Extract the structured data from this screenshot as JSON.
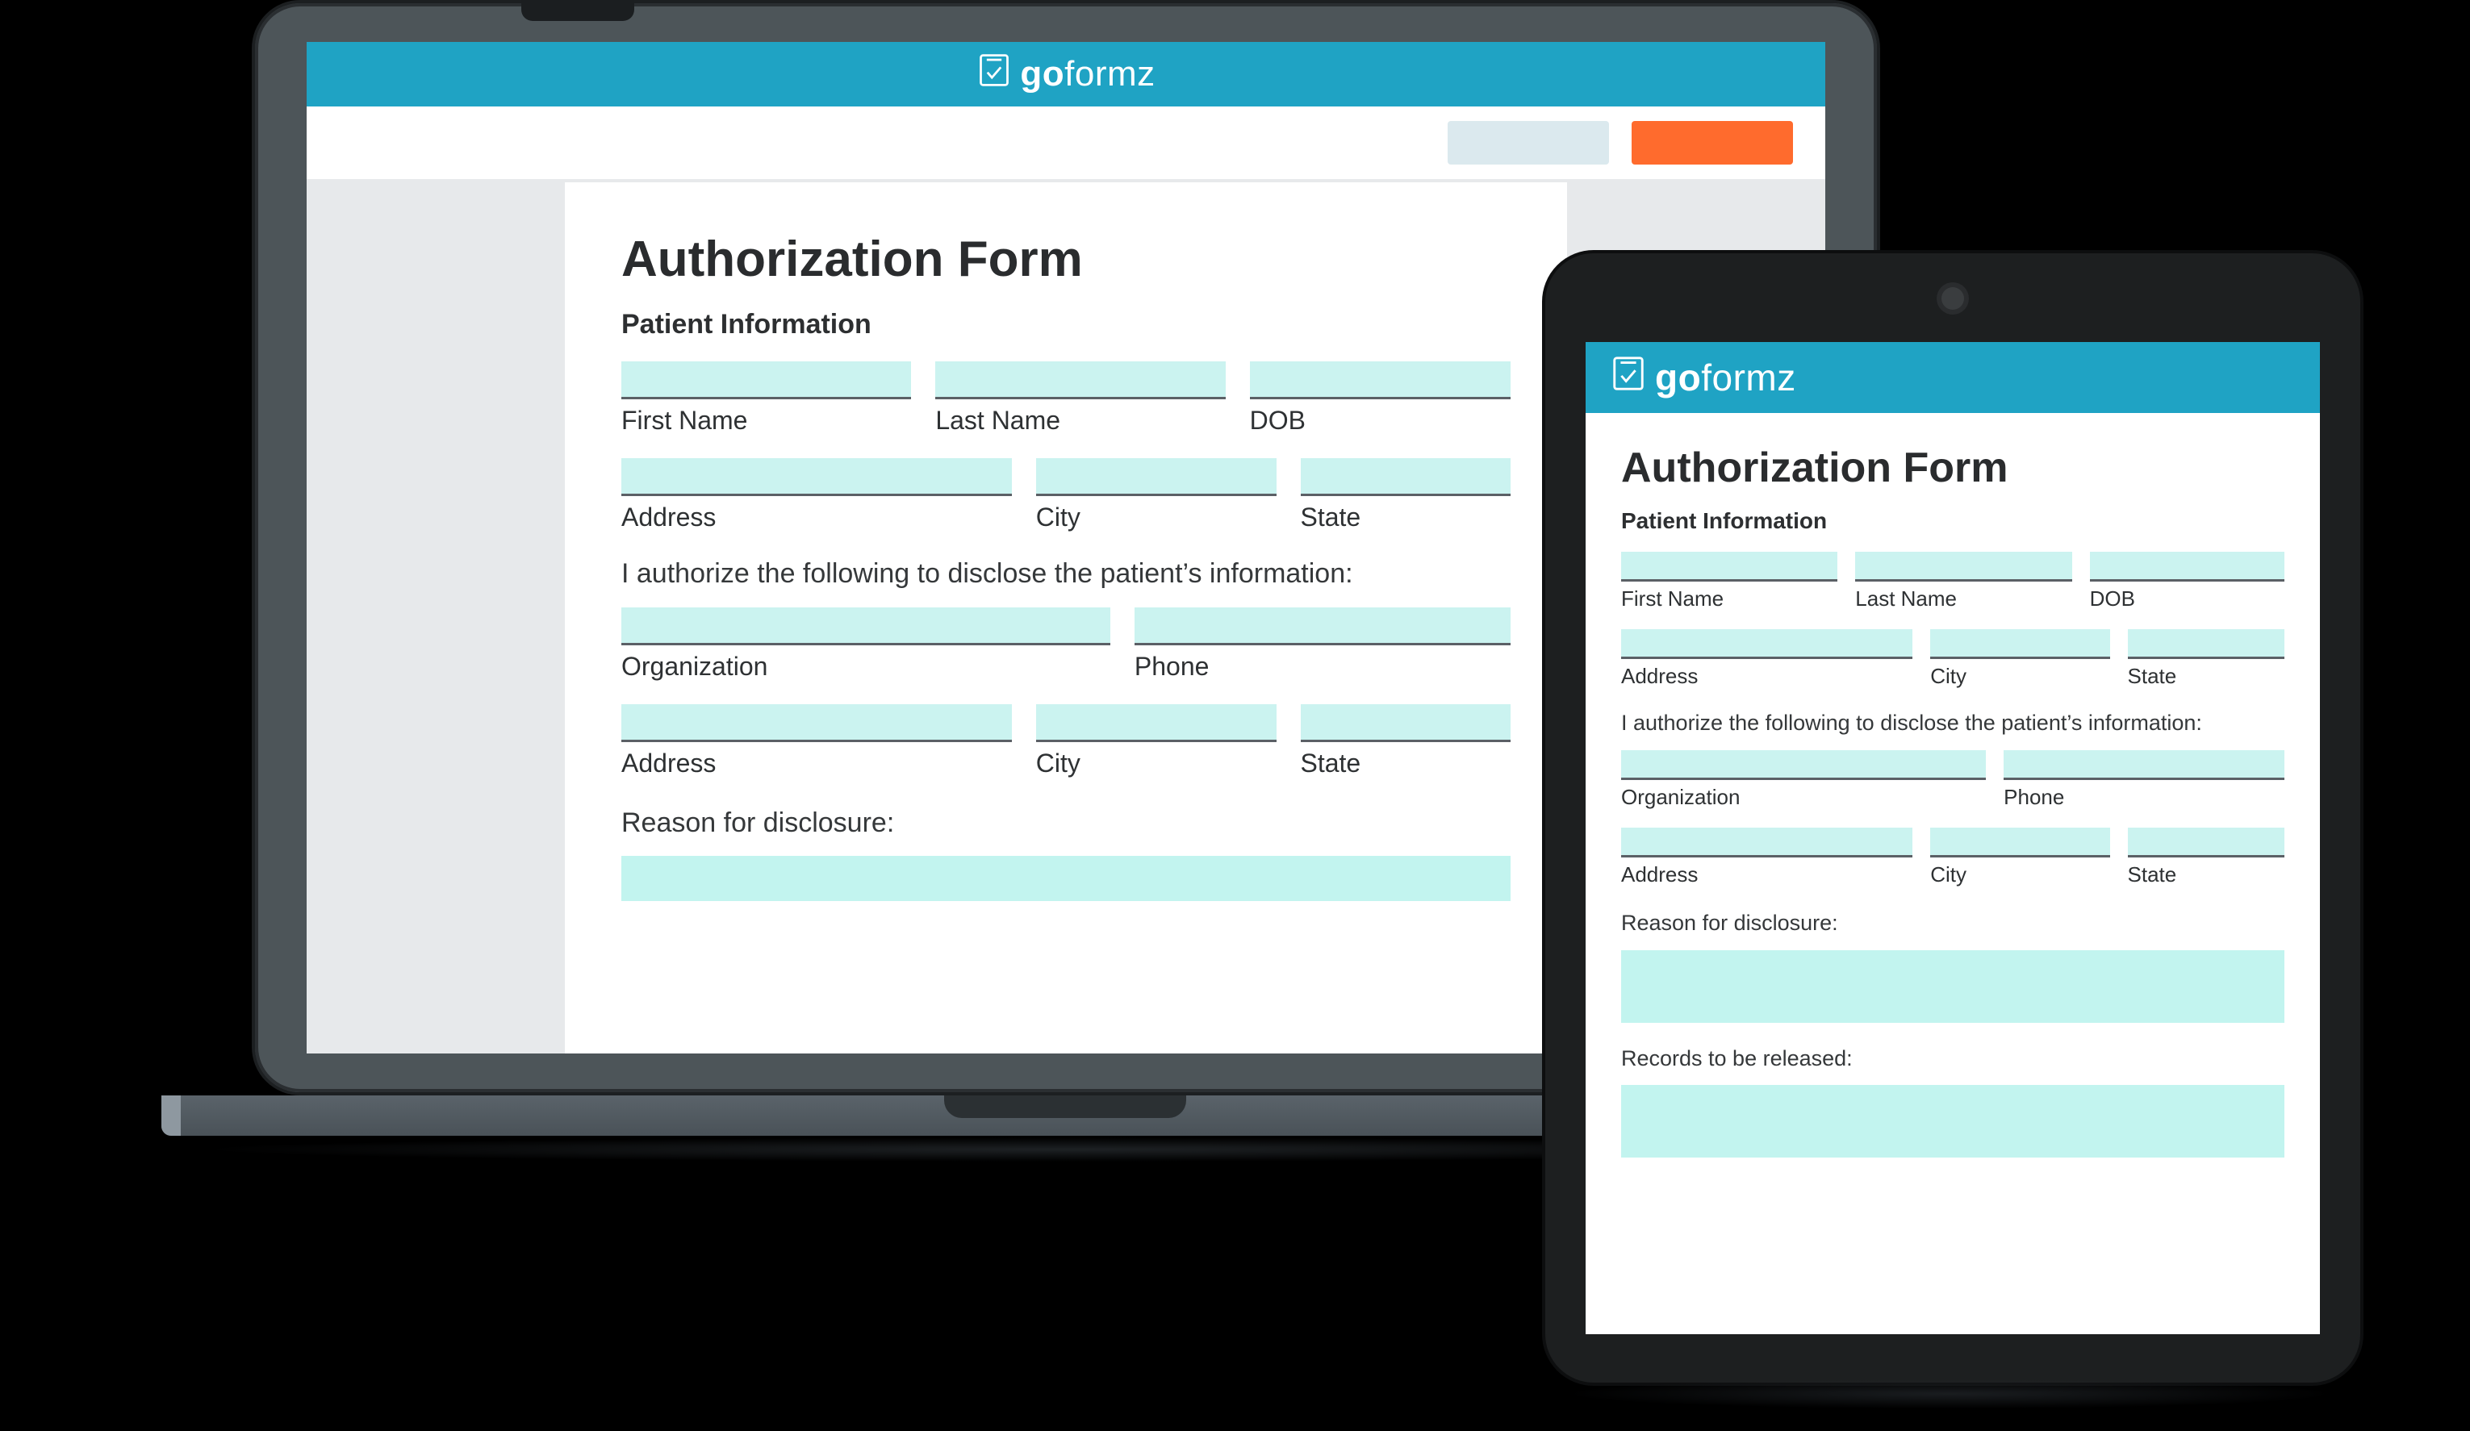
{
  "brand": {
    "name": "goformz",
    "bold_part": "go",
    "light_part": "formz"
  },
  "colors": {
    "teal": "#1fa3c4",
    "orange": "#ff6b2d",
    "mint": "#cbf3f0"
  },
  "form": {
    "title": "Authorization Form",
    "section_patient": "Patient Information",
    "row1": {
      "first_name": "First Name",
      "last_name": "Last Name",
      "dob": "DOB"
    },
    "row2": {
      "address": "Address",
      "city": "City",
      "state": "State"
    },
    "authorize_text": "I authorize the following to disclose the patient’s information:",
    "row3": {
      "organization": "Organization",
      "phone": "Phone"
    },
    "row4": {
      "address": "Address",
      "city": "City",
      "state": "State"
    },
    "reason_label": "Reason for disclosure:",
    "records_label": "Records to be released:"
  }
}
